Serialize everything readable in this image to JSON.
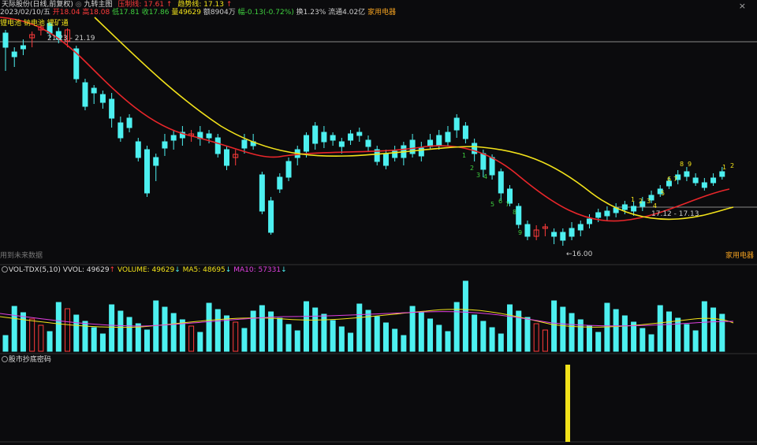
{
  "header": {
    "stock_title": "天际股份(日线,前复权)",
    "indicator": "九转主图",
    "pressure_label": "压制线: 17.61",
    "trend_label": "趋势线: 17.13",
    "date": "2023/02/10/五",
    "open": "开18.04",
    "high": "高18.08",
    "low": "低17.81",
    "close": "收17.86",
    "volume": "量49629",
    "amount": "额8904万",
    "change": "幅-0.13(-0.72%)",
    "turnover": "换1.23%",
    "float_cap": "流通4.02亿",
    "sector": "家用电器",
    "close_icon": "×"
  },
  "main": {
    "tags": "锂电池 钠电池 锂矿通",
    "hline_label": "21.23 - 21.19",
    "support_label": "17.12 - 17.13",
    "low_label": "←16.00",
    "sector_tag": "家用电器",
    "future_label": "用到未来数据",
    "td_sell": [
      "1",
      "2",
      "3",
      "4",
      "5",
      "6",
      "7",
      "8",
      "9"
    ],
    "td_buy_late": [
      "1",
      "2"
    ],
    "colors": {
      "up": "#ff3b3b",
      "down": "#4df0f0",
      "ma_red": "#e8262a",
      "ma_yellow": "#f2e21a"
    }
  },
  "vol": {
    "name": "VOL-TDX(5,10)",
    "vvol": "VVOL: 49629",
    "volume": "VOLUME: 49629",
    "ma5": "MA5: 48695",
    "ma10": "MA10: 57331"
  },
  "bottom": {
    "name": "股市抄底密码"
  }
}
